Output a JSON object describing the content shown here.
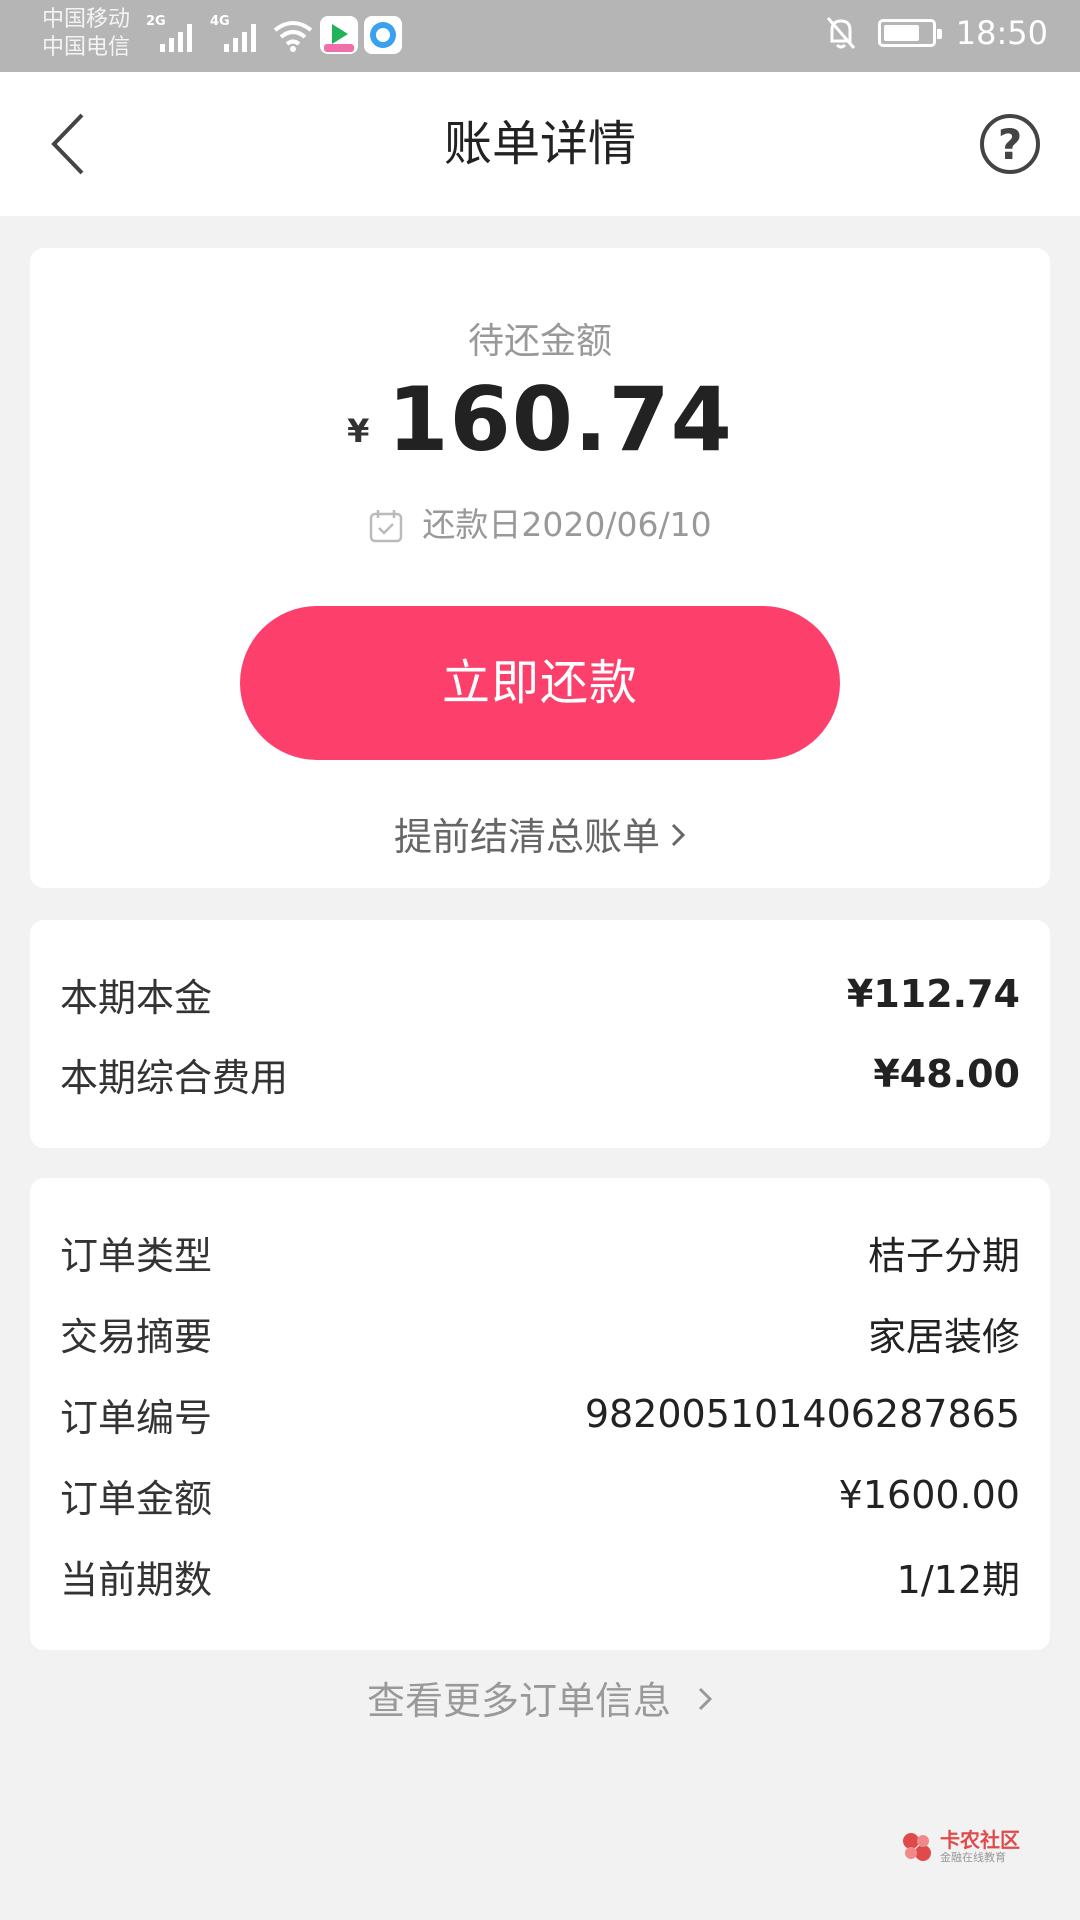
{
  "status_bar": {
    "carrier1": "中国移动",
    "carrier2": "中国电信",
    "net1": "2G",
    "net2": "4G",
    "time": "18:50",
    "battery_level": 0.75,
    "icons": [
      "signal-icon",
      "wifi-icon",
      "app-video-icon",
      "app-browser-icon",
      "bell-muted-icon",
      "battery-icon"
    ]
  },
  "header": {
    "title": "账单详情",
    "back_icon": "chevron-left-icon",
    "help_label": "?"
  },
  "summary": {
    "due_label": "待还金额",
    "currency": "¥",
    "amount": "160.74",
    "due_date": "还款日2020/06/10",
    "pay_button": "立即还款",
    "settle_link": "提前结清总账单"
  },
  "charges": [
    {
      "label": "本期本金",
      "value": "¥112.74"
    },
    {
      "label": "本期综合费用",
      "value": "¥48.00"
    }
  ],
  "order": [
    {
      "label": "订单类型",
      "value": "桔子分期"
    },
    {
      "label": "交易摘要",
      "value": "家居装修"
    },
    {
      "label": "订单编号",
      "value": "982005101406287865"
    },
    {
      "label": "订单金额",
      "value": "¥1600.00"
    },
    {
      "label": "当前期数",
      "value": "1/12期"
    }
  ],
  "more_link": "查看更多订单信息",
  "watermark": {
    "main": "卡农社区",
    "sub": "金融在线教育"
  },
  "colors": {
    "accent": "#fd3f6c",
    "background": "#f2f2f2",
    "status_bar": "#b5b5b5"
  }
}
